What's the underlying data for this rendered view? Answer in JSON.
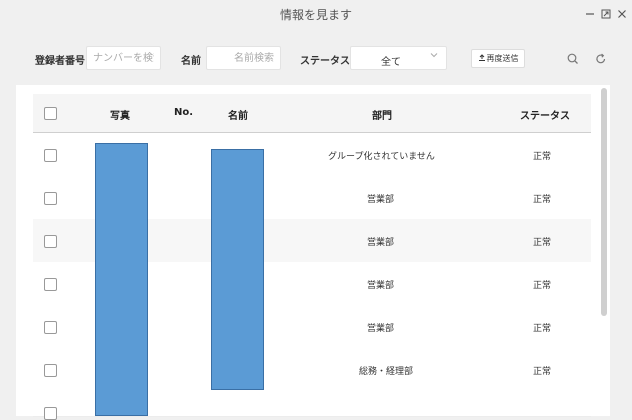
{
  "window": {
    "title": "情報を見ます"
  },
  "filters": {
    "id_label": "登録者番号",
    "id_placeholder": "ナンバーを検索",
    "name_label": "名前",
    "name_placeholder": "名前検索",
    "status_label": "ステータス",
    "status_value": "全て",
    "resend_label": "再度送信"
  },
  "icons": {
    "minimize": "minimize-icon",
    "maximize": "maximize-icon",
    "close": "close-icon",
    "search": "search-icon",
    "refresh": "refresh-icon",
    "upload": "upload-icon",
    "chevron": "chevron-down-icon"
  },
  "table": {
    "headers": {
      "photo": "写真",
      "no": "No.",
      "name": "名前",
      "dept": "部門",
      "status": "ステータス"
    },
    "rows": [
      {
        "dept": "グループ化されていません",
        "status": "正常"
      },
      {
        "dept": "営業部",
        "status": "正常"
      },
      {
        "dept": "営業部",
        "status": "正常"
      },
      {
        "dept": "営業部",
        "status": "正常"
      },
      {
        "dept": "営業部",
        "status": "正常"
      },
      {
        "dept": "総務・経理部",
        "status": "正常"
      }
    ]
  },
  "colors": {
    "redaction": "#5b9bd5",
    "panel": "#ffffff",
    "background": "#f0f0f0"
  }
}
